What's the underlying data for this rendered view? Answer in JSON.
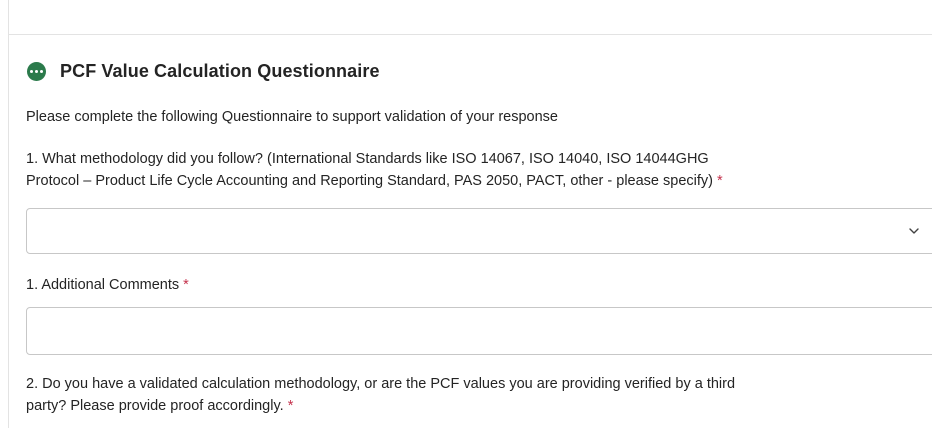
{
  "section": {
    "title": "PCF Value Calculation Questionnaire",
    "icon": "more-horizontal-icon",
    "accent_color": "#2b7a4b"
  },
  "intro_text": "Please complete the following Questionnaire to support validation of your response",
  "questions": [
    {
      "line1": "1. What methodology did you follow? (International Standards like ISO 14067, ISO 14040, ISO 14044GHG",
      "line2": "Protocol – Product Life Cycle Accounting and Reporting Standard, PAS 2050, PACT, other - please specify)",
      "required_mark": "*",
      "selected_value": ""
    },
    {
      "label": "1. Additional Comments",
      "required_mark": "*",
      "value": ""
    },
    {
      "line1": "2. Do you have a validated calculation methodology, or are the PCF values you are providing verified by a third",
      "line2": "party? Please provide proof accordingly.",
      "required_mark": "*"
    }
  ],
  "colors": {
    "required": "#c4314b",
    "border": "#c7c7c7",
    "text": "#242424"
  }
}
